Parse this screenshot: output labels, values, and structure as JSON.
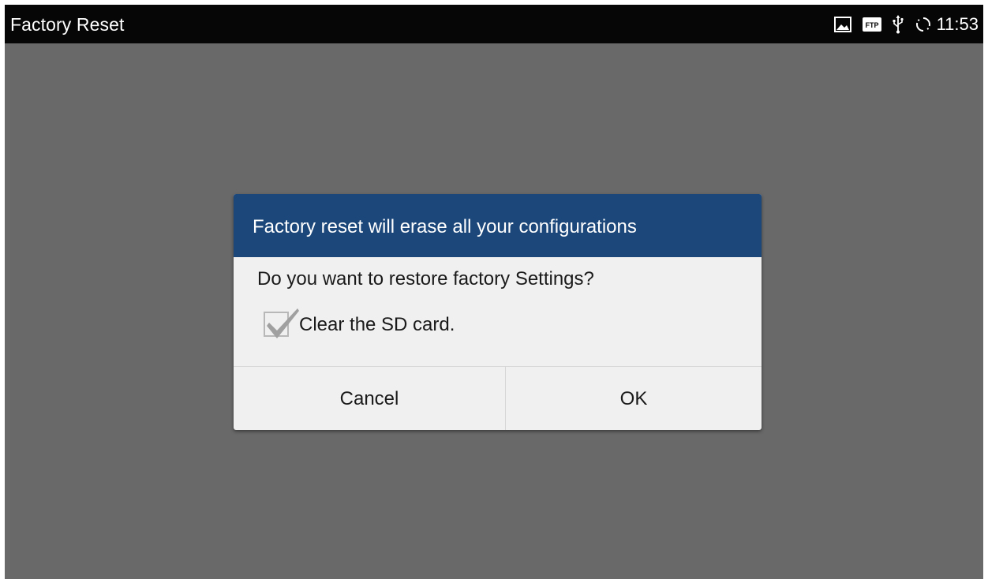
{
  "status_bar": {
    "title": "Factory Reset",
    "time": "11:53",
    "icons": [
      "image-icon",
      "ftp-icon",
      "usb-icon",
      "sync-icon"
    ],
    "ftp_icon_text": "FTP"
  },
  "dialog": {
    "title": "Factory reset will erase all your configurations",
    "message": "Do you want to restore factory Settings?",
    "checkbox": {
      "label": "Clear the SD card.",
      "checked": true
    },
    "buttons": {
      "cancel": "Cancel",
      "ok": "OK"
    }
  },
  "colors": {
    "status_bar_bg": "#060606",
    "screen_bg": "#696969",
    "dialog_header_bg": "#1c477a",
    "dialog_body_bg": "#f0f0f0"
  }
}
